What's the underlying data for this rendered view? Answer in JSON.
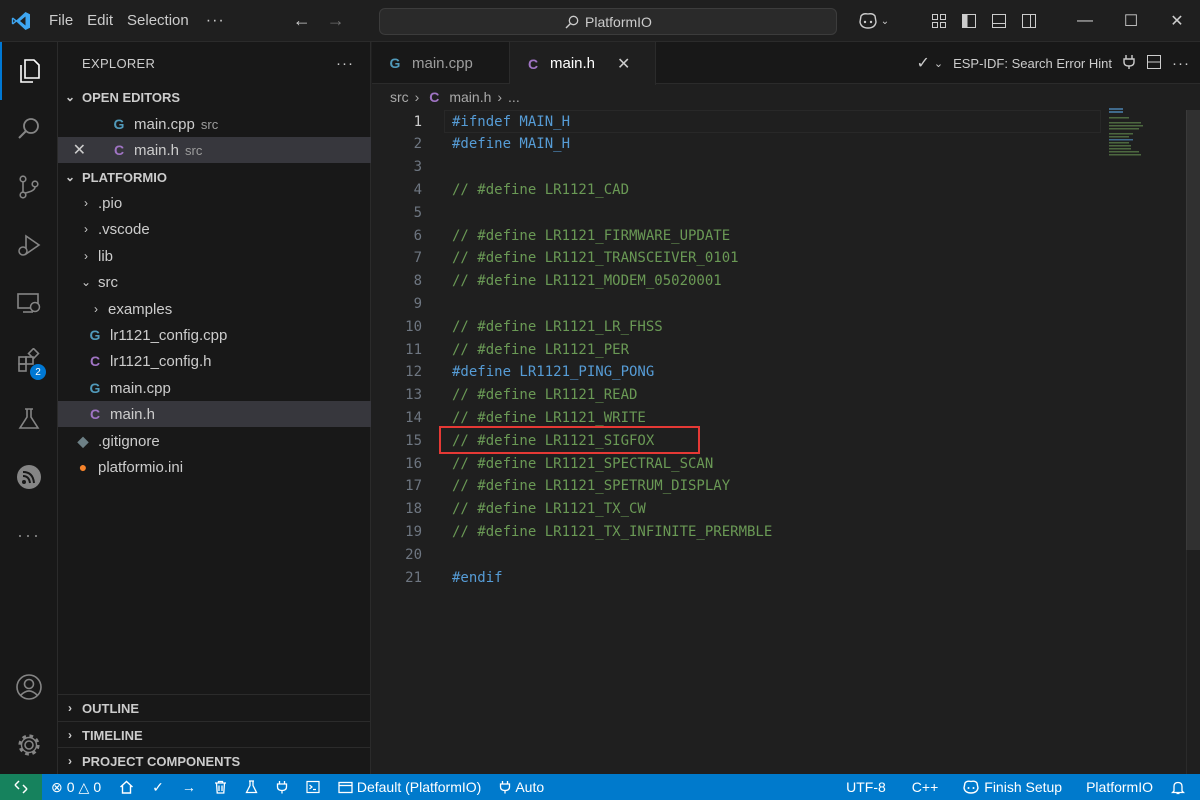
{
  "titlebar": {
    "menu": [
      "File",
      "Edit",
      "Selection"
    ],
    "more": "···",
    "search": "PlatformIO"
  },
  "activity": {
    "extensions_badge": "2"
  },
  "sidebar": {
    "title": "EXPLORER",
    "more": "···",
    "open_editors": {
      "title": "OPEN EDITORS",
      "items": [
        {
          "name": "main.cpp",
          "desc": "src"
        },
        {
          "name": "main.h",
          "desc": "src"
        }
      ]
    },
    "project": {
      "title": "PLATFORMIO",
      "items": [
        ".pio",
        ".vscode",
        "lib",
        "src",
        "examples",
        "lr1121_config.cpp",
        "lr1121_config.h",
        "main.cpp",
        "main.h",
        ".gitignore",
        "platformio.ini"
      ]
    },
    "bottom_sections": [
      "OUTLINE",
      "TIMELINE",
      "PROJECT COMPONENTS"
    ]
  },
  "editor": {
    "tabs": [
      "main.cpp",
      "main.h"
    ],
    "actions": {
      "hint": "ESP-IDF: Search Error Hint",
      "more": "···"
    },
    "breadcrumb": [
      "src",
      "main.h",
      "..."
    ],
    "lines": [
      {
        "n": "1",
        "parts": [
          {
            "t": "#ifndef MAIN_H",
            "c": "kw"
          }
        ]
      },
      {
        "n": "2",
        "parts": [
          {
            "t": "#define MAIN_H",
            "c": "kw"
          }
        ]
      },
      {
        "n": "3",
        "parts": []
      },
      {
        "n": "4",
        "parts": [
          {
            "t": "// #define LR1121_CAD",
            "c": "cm"
          }
        ]
      },
      {
        "n": "5",
        "parts": []
      },
      {
        "n": "6",
        "parts": [
          {
            "t": "// #define LR1121_FIRMWARE_UPDATE",
            "c": "cm"
          }
        ]
      },
      {
        "n": "7",
        "parts": [
          {
            "t": "// #define LR1121_TRANSCEIVER_0101",
            "c": "cm"
          }
        ]
      },
      {
        "n": "8",
        "parts": [
          {
            "t": "// #define LR1121_MODEM_05020001",
            "c": "cm"
          }
        ]
      },
      {
        "n": "9",
        "parts": []
      },
      {
        "n": "10",
        "parts": [
          {
            "t": "// #define LR1121_LR_FHSS",
            "c": "cm"
          }
        ]
      },
      {
        "n": "11",
        "parts": [
          {
            "t": "// #define LR1121_PER",
            "c": "cm"
          }
        ]
      },
      {
        "n": "12",
        "parts": [
          {
            "t": "#define LR1121_PING_PONG",
            "c": "kw"
          }
        ]
      },
      {
        "n": "13",
        "parts": [
          {
            "t": "// #define LR1121_READ",
            "c": "cm"
          }
        ]
      },
      {
        "n": "14",
        "parts": [
          {
            "t": "// #define LR1121_WRITE",
            "c": "cm"
          }
        ]
      },
      {
        "n": "15",
        "parts": [
          {
            "t": "// #define LR1121_SIGFOX",
            "c": "cm"
          }
        ]
      },
      {
        "n": "16",
        "parts": [
          {
            "t": "// #define LR1121_SPECTRAL_SCAN",
            "c": "cm"
          }
        ]
      },
      {
        "n": "17",
        "parts": [
          {
            "t": "// #define LR1121_SPETRUM_DISPLAY",
            "c": "cm"
          }
        ]
      },
      {
        "n": "18",
        "parts": [
          {
            "t": "// #define LR1121_TX_CW",
            "c": "cm"
          }
        ]
      },
      {
        "n": "19",
        "parts": [
          {
            "t": "// #define LR1121_TX_INFINITE_PRERMBLE",
            "c": "cm"
          }
        ]
      },
      {
        "n": "20",
        "parts": []
      },
      {
        "n": "21",
        "parts": [
          {
            "t": "#endif",
            "c": "kw"
          }
        ]
      }
    ]
  },
  "statusbar": {
    "errors": "0",
    "warnings": "0",
    "env": "Default (PlatformIO)",
    "port": "Auto",
    "encoding": "UTF-8",
    "language": "C++",
    "finish_setup": "Finish Setup",
    "platformio": "PlatformIO"
  },
  "colors": {
    "accent": "#007acc",
    "keyword": "#569cd6",
    "comment": "#6a9955",
    "highlight_box": "#e53935"
  }
}
